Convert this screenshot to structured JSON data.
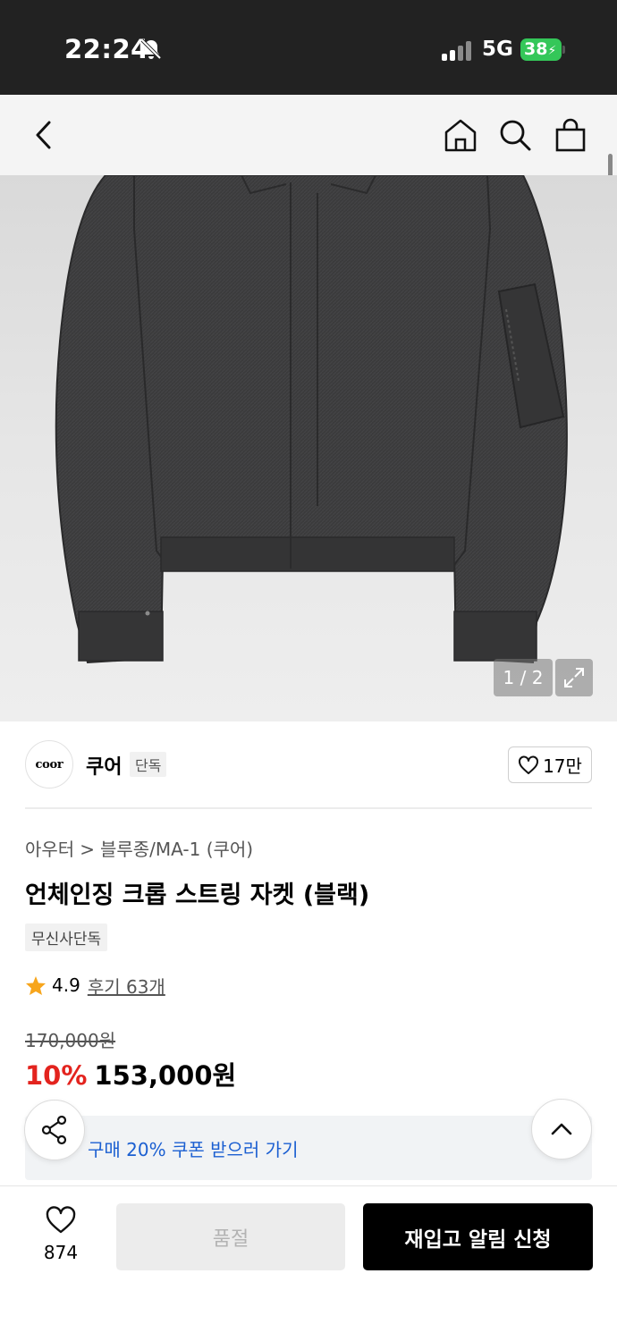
{
  "status_bar": {
    "time": "22:24",
    "network": "5G",
    "battery": "38"
  },
  "hero": {
    "counter": "1 / 2"
  },
  "brand": {
    "logo_text": "coor",
    "name": "쿠어",
    "tag": "단독",
    "likes": "17만"
  },
  "product": {
    "breadcrumb": [
      "아우터",
      "블루종/MA-1 (쿠어)"
    ],
    "title": "언체인징 크롭 스트링 자켓 (블랙)",
    "exclusive_tag": "무신사단독",
    "rating": "4.9",
    "reviews": "후기 63개",
    "original_price": "170,000원",
    "discount": "10%",
    "price": "153,000원"
  },
  "coupon": {
    "text": "구매 20% 쿠폰 받으러 가기"
  },
  "bottom_bar": {
    "wish_count": "874",
    "soldout_label": "품절",
    "restock_label": "재입고 알림 신청"
  },
  "colors": {
    "discount": "#e3231e",
    "coupon_link": "#1b5fd1",
    "battery": "#34c759"
  }
}
